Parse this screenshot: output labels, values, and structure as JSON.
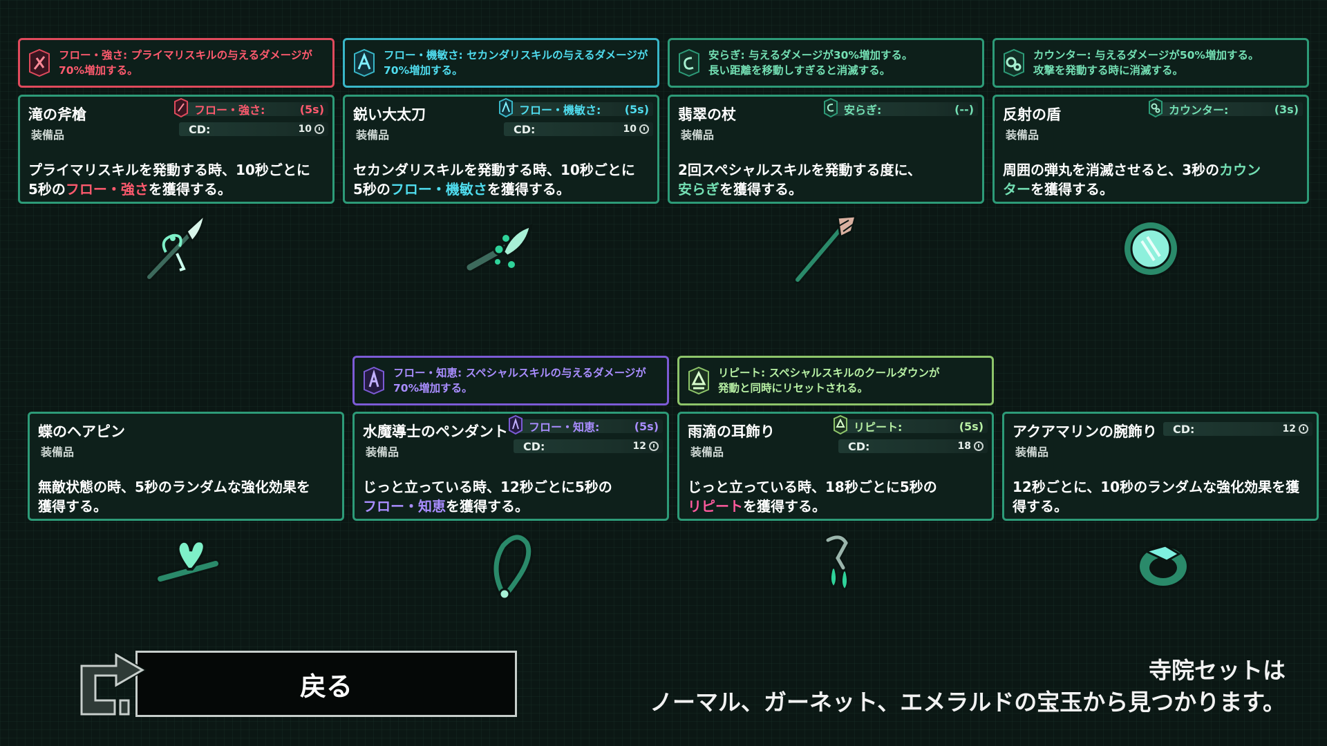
{
  "colors": {
    "red": "#ff5a6e",
    "cyan": "#4fdcee",
    "green": "#74e0b4",
    "purple": "#a98dff",
    "lime": "#b8f0a4",
    "pink": "#ff5a9e"
  },
  "row1": [
    {
      "tooltip": {
        "text": "フロー・強さ: プライマリスキルの与えるダメージが70%増加する。",
        "icon": "flow-strength-icon"
      },
      "name": "滝の斧槍",
      "kind": "装備品",
      "buff": {
        "label": "フロー・強さ:",
        "dur": "(5s)"
      },
      "cd": {
        "label": "CD:",
        "val": "10"
      },
      "desc_a": "プライマリスキルを発動する時、10秒ごとに",
      "desc_b": "5秒の",
      "desc_hl": "フロー・強さ",
      "desc_c": "を獲得する。",
      "weapon": "halberd-icon"
    },
    {
      "tooltip": {
        "text": "フロー・機敏さ: セカンダリスキルの与えるダメージが70%増加する。",
        "icon": "flow-agility-icon"
      },
      "name": "鋭い大太刀",
      "kind": "装備品",
      "buff": {
        "label": "フロー・機敏さ:",
        "dur": "(5s)"
      },
      "cd": {
        "label": "CD:",
        "val": "10"
      },
      "desc_a": "セカンダリスキルを発動する時、10秒ごとに",
      "desc_b": "5秒の",
      "desc_hl": "フロー・機敏さ",
      "desc_c": "を獲得する。",
      "weapon": "greatsword-icon"
    },
    {
      "tooltip": {
        "text_a": "安らぎ: 与えるダメージが30%増加する。",
        "text_b": "長い距離を移動しすぎると消滅する。",
        "icon": "calm-icon"
      },
      "name": "翡翠の杖",
      "kind": "装備品",
      "buff": {
        "label": "安らぎ:",
        "dur": "(--)"
      },
      "desc_a": "2回スペシャルスキルを発動する度に、",
      "desc_hl": "安らぎ",
      "desc_c": "を獲得する。",
      "weapon": "staff-icon"
    },
    {
      "tooltip": {
        "text_a": "カウンター: 与えるダメージが50%増加する。",
        "text_b": "攻撃を発動する時に消滅する。",
        "icon": "counter-icon"
      },
      "name": "反射の盾",
      "kind": "装備品",
      "buff": {
        "label": "カウンター:",
        "dur": "(3s)"
      },
      "desc_a": "周囲の弾丸を消滅させると、3秒の",
      "desc_hl_a": "カウン",
      "desc_hl_b": "ター",
      "desc_c": "を獲得する。",
      "weapon": "shield-icon"
    }
  ],
  "row2": [
    {
      "name": "蝶のヘアピン",
      "kind": "装備品",
      "desc_a": "無敵状態の時、5秒のランダムな強化効果を",
      "desc_b": "獲得する。",
      "weapon": "hairpin-icon"
    },
    {
      "tooltip": {
        "text": "フロー・知恵: スペシャルスキルの与えるダメージが70%増加する。",
        "icon": "flow-wisdom-icon"
      },
      "name": "水魔導士のペンダント",
      "kind": "装備品",
      "buff": {
        "label": "フロー・知恵:",
        "dur": "(5s)"
      },
      "cd": {
        "label": "CD:",
        "val": "12"
      },
      "desc_a": "じっと立っている時、12秒ごとに5秒の",
      "desc_hl": "フロー・知恵",
      "desc_c": "を獲得する。",
      "weapon": "pendant-icon"
    },
    {
      "tooltip": {
        "text_a": "リピート: スペシャルスキルのクールダウンが",
        "text_b": "発動と同時にリセットされる。",
        "icon": "repeat-icon"
      },
      "name": "雨滴の耳飾り",
      "kind": "装備品",
      "buff": {
        "label": "リピート:",
        "dur": "(5s)"
      },
      "cd": {
        "label": "CD:",
        "val": "18"
      },
      "desc_a": "じっと立っている時、18秒ごとに5秒の",
      "desc_hl": "リピート",
      "desc_c": "を獲得する。",
      "weapon": "earring-icon"
    },
    {
      "name": "アクアマリンの腕飾り",
      "kind": "装備品",
      "cd": {
        "label": "CD:",
        "val": "12"
      },
      "desc_a": "12秒ごとに、10秒のランダムな強化効果を獲",
      "desc_b": "得する。",
      "weapon": "bracelet-icon"
    }
  ],
  "back_button": {
    "label": "戻る",
    "icon": "return-arrow-icon"
  },
  "footer": {
    "line1": "寺院セットは",
    "line2": "ノーマル、ガーネット、エメラルドの宝玉から見つかります。"
  }
}
